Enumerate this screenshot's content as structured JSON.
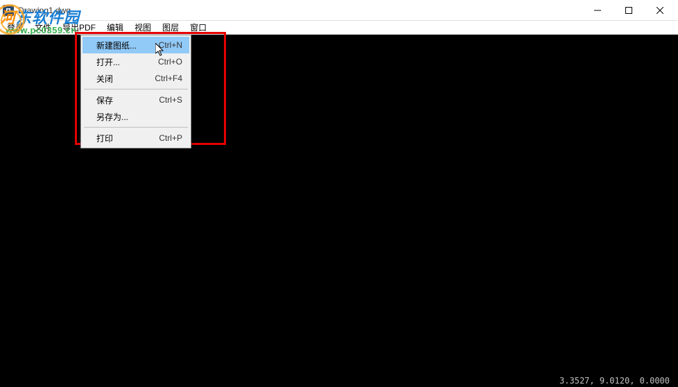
{
  "titlebar": {
    "title": "Drawing1.dwg"
  },
  "menubar": {
    "items": [
      "登录",
      "文件",
      "导出PDF",
      "编辑",
      "视图",
      "图层",
      "窗口"
    ]
  },
  "watermark": {
    "brand": "河东软件园",
    "url": "www.pc0359.cn"
  },
  "dropdown": {
    "items": [
      {
        "label": "新建图纸...",
        "shortcut": "Ctrl+N",
        "highlighted": true
      },
      {
        "label": "打开...",
        "shortcut": "Ctrl+O"
      },
      {
        "label": "关闭",
        "shortcut": "Ctrl+F4"
      }
    ],
    "items2": [
      {
        "label": "保存",
        "shortcut": "Ctrl+S"
      },
      {
        "label": "另存为...",
        "shortcut": ""
      }
    ],
    "items3": [
      {
        "label": "打印",
        "shortcut": "Ctrl+P"
      }
    ]
  },
  "statusbar": {
    "coords": "3.3527, 9.0120, 0.0000"
  }
}
